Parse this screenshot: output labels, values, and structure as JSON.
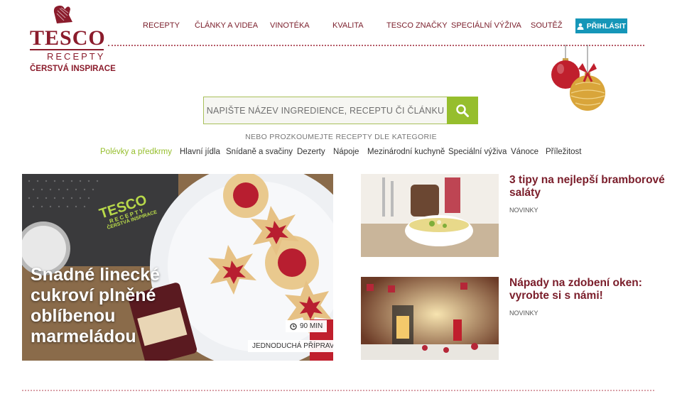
{
  "logo": {
    "brand": "TESCO",
    "sub": "RECEPTY",
    "tagline": "ČERSTVÁ INSPIRACE"
  },
  "nav": {
    "items": [
      "RECEPTY",
      "ČLÁNKY A VIDEA",
      "VINOTÉKA",
      "KVALITA",
      "TESCO ZNAČKY",
      "SPECIÁLNÍ VÝŽIVA",
      "SOUTĚŽ"
    ],
    "login_label": "PŘIHLÁSIT"
  },
  "search": {
    "placeholder": "NAPIŠTE NÁZEV INGREDIENCE, RECEPTU ČI ČLÁNKU"
  },
  "explore_label": "NEBO PROZKOUMEJTE RECEPTY DLE KATEGORIE",
  "categories": [
    "Polévky a předkrmy",
    "Hlavní jídla",
    "Snídaně a svačiny",
    "Dezerty",
    "Nápoje",
    "Mezinárodní kuchyně",
    "Speciální výživa",
    "Vánoce",
    "Příležitost"
  ],
  "hero": {
    "title": "Snadné linecké cukroví plněné oblíbenou marmeládou",
    "time": "90 MIN",
    "difficulty": "JEDNODUCHÁ PŘÍPRAVA",
    "watermark": "TESCO",
    "watermark_sub": "RECEPTY",
    "watermark_tag": "ČERSTVÁ INSPIRACE"
  },
  "articles": [
    {
      "title": "3 tipy na nejlepší bramborové saláty",
      "tag": "NOVINKY"
    },
    {
      "title": "Nápady na zdobení oken: vyrobte si s námi!",
      "tag": "NOVINKY"
    }
  ],
  "colors": {
    "brand": "#8b1c2c",
    "accent": "#96be2d",
    "login": "#1596b8"
  }
}
